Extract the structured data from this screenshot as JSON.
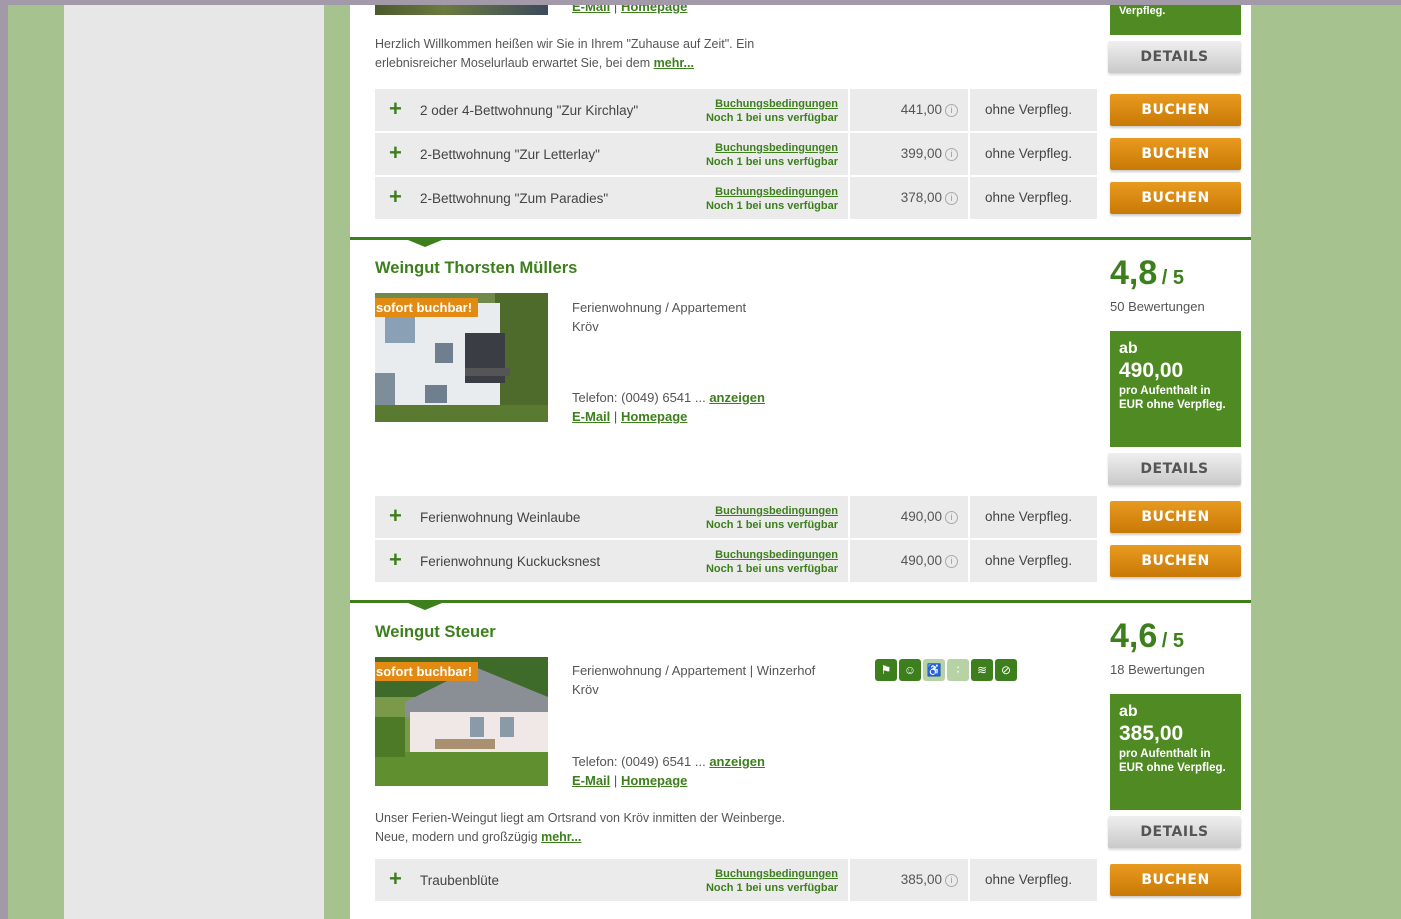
{
  "top_card": {
    "links": {
      "email": "E-Mail",
      "sep": "|",
      "homepage": "Homepage"
    },
    "price_tail": "Verpfleg.",
    "details_label": "DETAILS",
    "intro": "Herzlich Willkommen heißen wir Sie in Ihrem \"Zuhause auf Zeit\". Ein erlebnisreicher Moselurlaub erwartet Sie, bei dem",
    "more": "mehr...",
    "offers": [
      {
        "name": "2 oder 4-Bettwohnung \"Zur Kirchlay\"",
        "terms": "Buchungsbedingungen",
        "avail": "Noch 1 bei uns verfügbar",
        "price": "441,00",
        "board": "ohne Verpfleg.",
        "book": "BUCHEN"
      },
      {
        "name": "2-Bettwohnung \"Zur Letterlay\"",
        "terms": "Buchungsbedingungen",
        "avail": "Noch 1 bei uns verfügbar",
        "price": "399,00",
        "board": "ohne Verpfleg.",
        "book": "BUCHEN"
      },
      {
        "name": "2-Bettwohnung \"Zum Paradies\"",
        "terms": "Buchungsbedingungen",
        "avail": "Noch 1 bei uns verfügbar",
        "price": "378,00",
        "board": "ohne Verpfleg.",
        "book": "BUCHEN"
      }
    ]
  },
  "cards": [
    {
      "title": "Weingut Thorsten Müllers",
      "badge": "sofort buchbar!",
      "type": "Ferienwohnung / Appartement",
      "town": "Kröv",
      "phone": "Telefon: (0049) 6541 ...",
      "show": "anzeigen",
      "email": "E-Mail",
      "sep": "|",
      "homepage": "Homepage",
      "rating": "4,8",
      "rating_max": "/ 5",
      "reviews": "50 Bewertungen",
      "price_ab": "ab",
      "price": "490,00",
      "price_note": "pro Aufenthalt in EUR ohne Verpfleg.",
      "details_label": "DETAILS",
      "offers": [
        {
          "name": "Ferienwohnung Weinlaube",
          "terms": "Buchungsbedingungen",
          "avail": "Noch 1 bei uns verfügbar",
          "price": "490,00",
          "board": "ohne Verpfleg.",
          "book": "BUCHEN"
        },
        {
          "name": "Ferienwohnung Kuckucksnest",
          "terms": "Buchungsbedingungen",
          "avail": "Noch 1 bei uns verfügbar",
          "price": "490,00",
          "board": "ohne Verpfleg.",
          "book": "BUCHEN"
        }
      ]
    },
    {
      "title": "Weingut Steuer",
      "badge": "sofort buchbar!",
      "type": "Ferienwohnung / Appartement | Winzerhof",
      "town": "Kröv",
      "phone": "Telefon: (0049) 6541 ...",
      "show": "anzeigen",
      "email": "E-Mail",
      "sep": "|",
      "homepage": "Homepage",
      "rating": "4,6",
      "rating_max": "/ 5",
      "reviews": "18 Bewertungen",
      "price_ab": "ab",
      "price": "385,00",
      "price_note": "pro Aufenthalt in EUR ohne Verpfleg.",
      "details_label": "DETAILS",
      "desc": "Unser Ferien-Weingut liegt am Ortsrand von Kröv inmitten der Weinberge. Neue, modern und großzügig",
      "more": "mehr...",
      "amenity_icons": [
        "pet-icon",
        "child-icon",
        "wheelchair-icon",
        "nosmoking-icon",
        "wifi-icon",
        "nonsmoker-icon"
      ],
      "offers": [
        {
          "name": "Traubenblüte",
          "terms": "Buchungsbedingungen",
          "avail": "Noch 1 bei uns verfügbar",
          "price": "385,00",
          "board": "ohne Verpfleg.",
          "book": "BUCHEN"
        }
      ]
    }
  ],
  "colors": {
    "accent": "#3d7f1c",
    "price_box": "#4f8a22",
    "book": "#d98a12",
    "frame": "#a6c28f"
  }
}
